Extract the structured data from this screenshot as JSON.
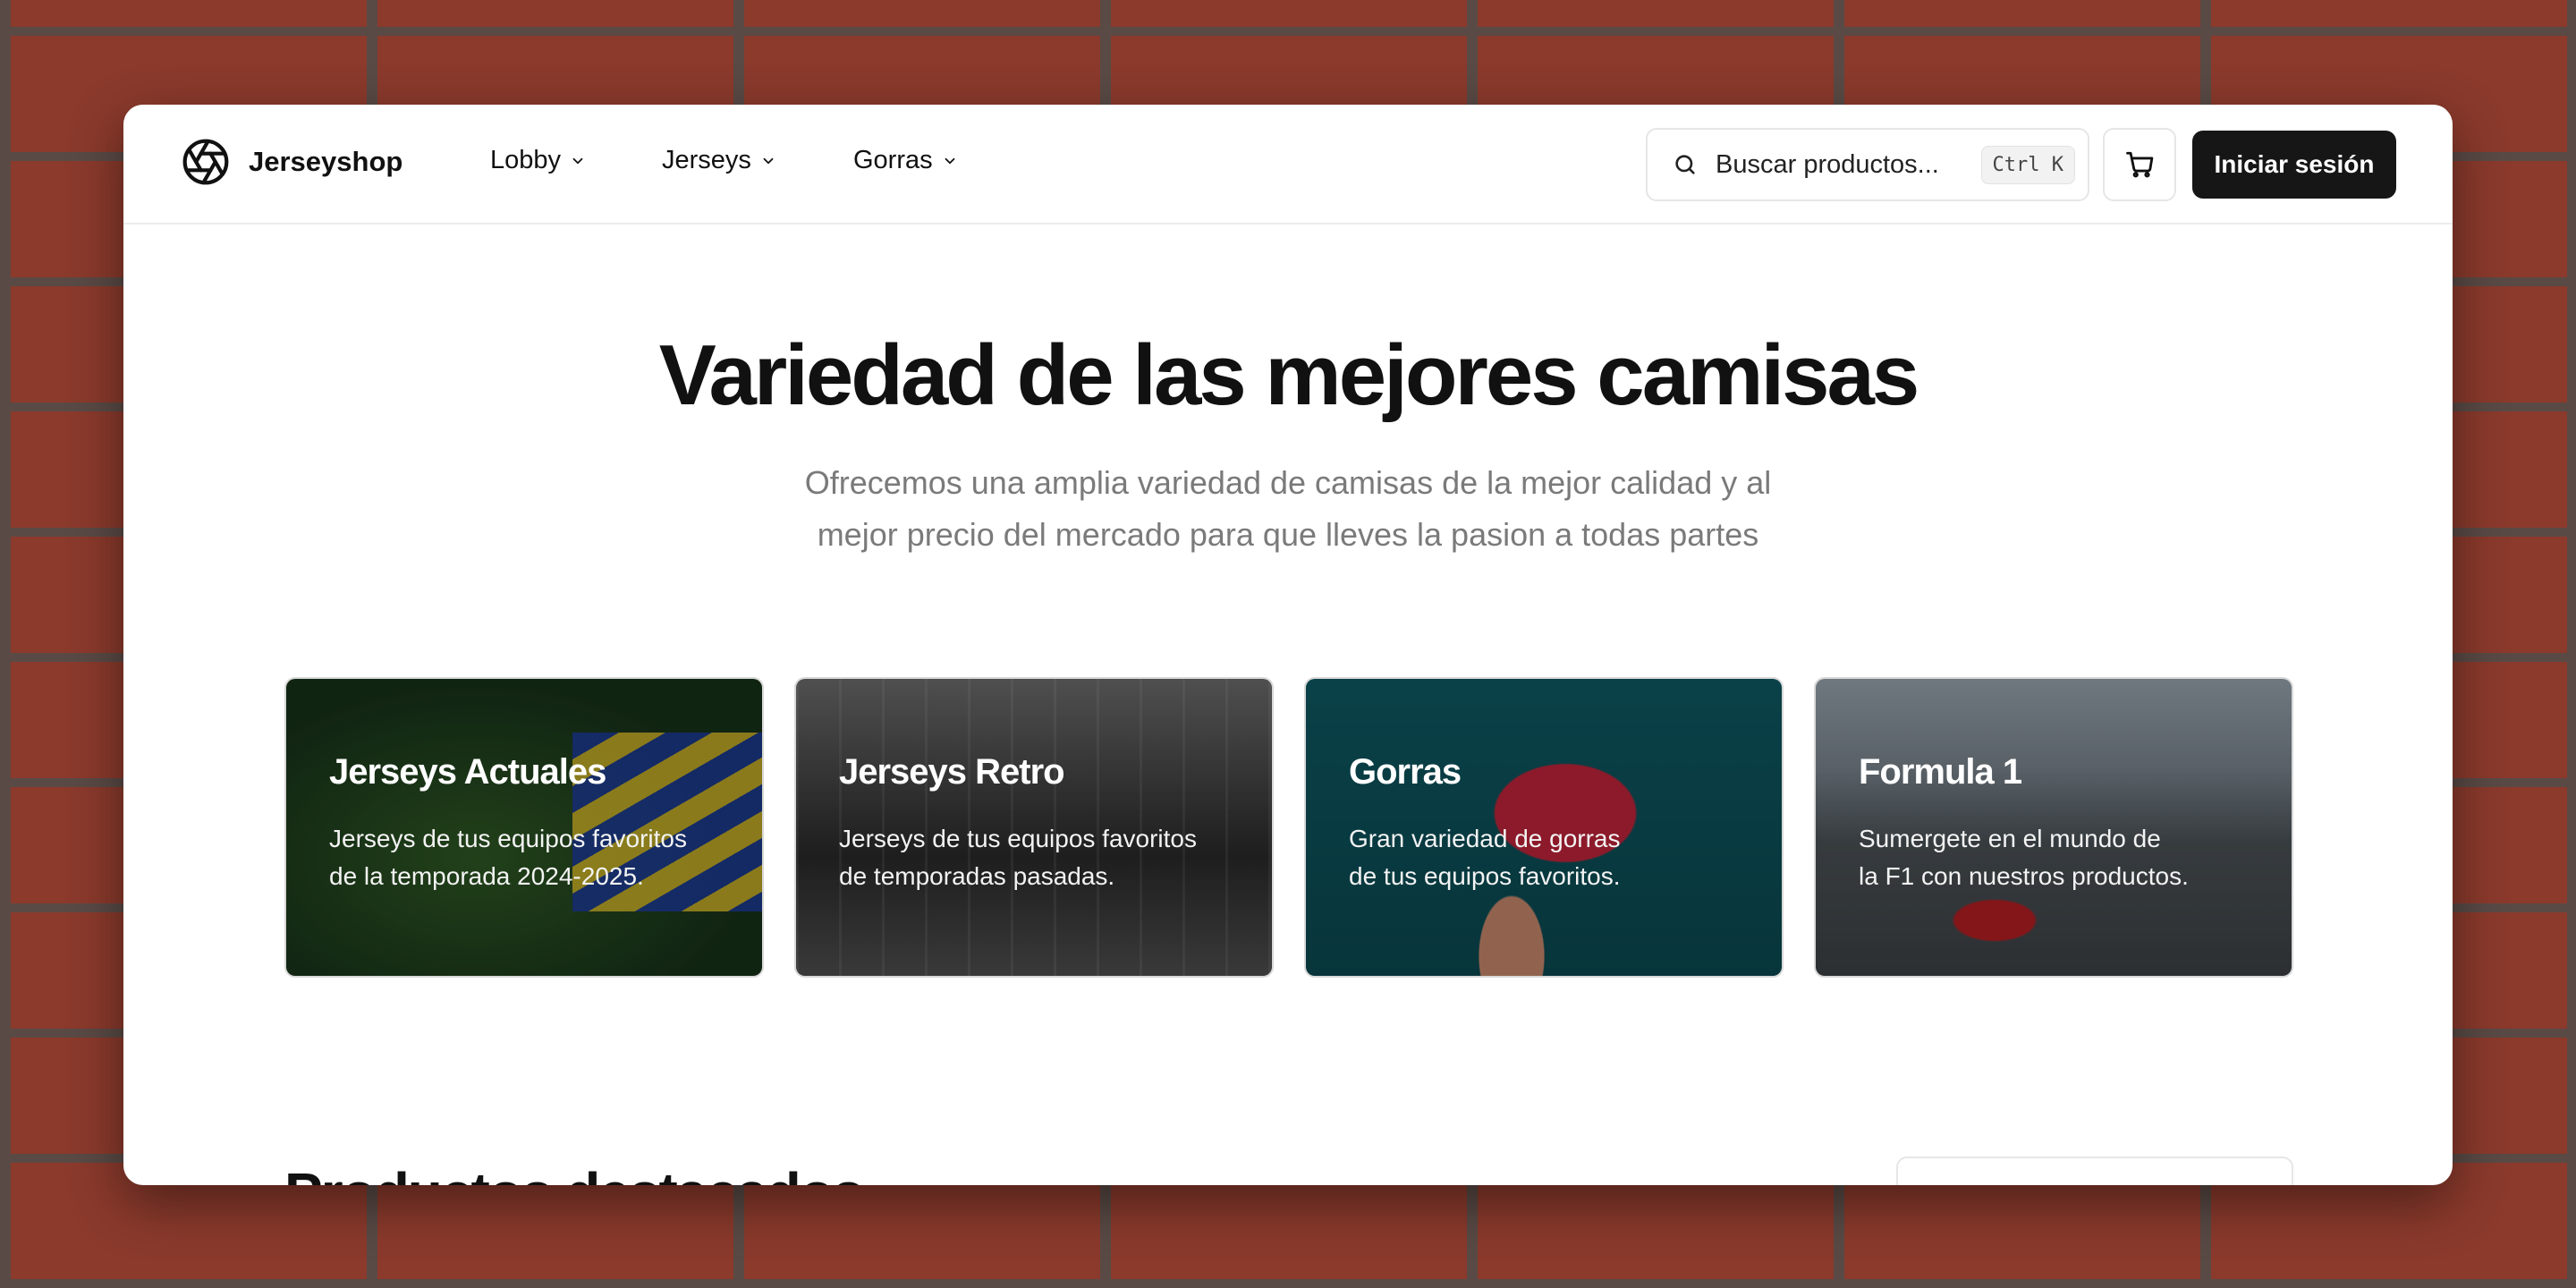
{
  "colors": {
    "brick": "#8b3a2c",
    "mortar": "#5a4a45",
    "primary_button": "#161616",
    "subtitle_text": "#7a7a7a"
  },
  "brand": {
    "name": "Jerseyshop",
    "icon": "aperture-icon"
  },
  "nav": {
    "items": [
      {
        "label": "Lobby",
        "icon": "chevron-down-icon"
      },
      {
        "label": "Jerseys",
        "icon": "chevron-down-icon"
      },
      {
        "label": "Gorras",
        "icon": "chevron-down-icon"
      }
    ]
  },
  "search": {
    "placeholder": "Buscar productos...",
    "shortcut": "Ctrl K",
    "icon": "search-icon"
  },
  "cart": {
    "icon": "cart-icon"
  },
  "login": {
    "label": "Iniciar sesión"
  },
  "hero": {
    "title": "Variedad de las mejores camisas",
    "subtitle_line1": "Ofrecemos una amplia variedad de camisas de la mejor calidad y al",
    "subtitle_line2": "mejor precio del mercado para que lleves la pasion a todas partes"
  },
  "categories": [
    {
      "title": "Jerseys Actuales",
      "line1": "Jerseys de tus equipos favoritos",
      "line2": "de la temporada 2024-2025."
    },
    {
      "title": "Jerseys Retro",
      "line1": "Jerseys de tus equipos favoritos",
      "line2": "de temporadas pasadas."
    },
    {
      "title": "Gorras",
      "line1": "Gran variedad de gorras",
      "line2": "de tus equipos favoritos."
    },
    {
      "title": "Formula 1",
      "line1": "Sumergete en el mundo de",
      "line2": "la F1 con nuestros productos."
    }
  ],
  "featured": {
    "title": "Productos destacados"
  }
}
